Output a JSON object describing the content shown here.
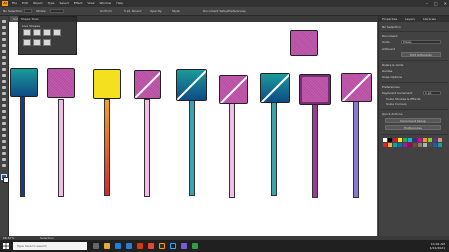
{
  "app": {
    "logo": "Ai"
  },
  "menu": [
    "File",
    "Edit",
    "Object",
    "Type",
    "Select",
    "Effect",
    "View",
    "Window",
    "Help"
  ],
  "window_controls": [
    "–",
    "□",
    "✕"
  ],
  "control_bar": {
    "label1": "No Selection",
    "label2": "Stroke",
    "label3": "Uniform",
    "label4": "5 pt. Round",
    "label5": "Opacity",
    "label6": "Style",
    "label7": "Document Setup",
    "label8": "Preferences"
  },
  "document_tab": "Untitled-1* @ 66.67 % (RGB/Preview)",
  "float_panel": {
    "title": "Shape Tools",
    "heading": "Live Shapes"
  },
  "right_panel": {
    "tabs": [
      "Properties",
      "Layers",
      "Libraries"
    ],
    "section": "No Selection",
    "document": "Document",
    "units_label": "Units",
    "units": "Pixels",
    "artboard_label": "Artboard",
    "edit_artboards": "Edit Artboards",
    "ruler_grids": "Rulers & Grids",
    "guides": "Guides",
    "snap": "Snap Options",
    "preferences": "Preferences",
    "keyboard_increment": "Keyboard Increment",
    "increment_value": "1 px",
    "scale_strokes": "Scale Strokes & Effects",
    "scale_corners": "Scale Corners",
    "quick_actions": "Quick Actions",
    "doc_setup": "Document Setup",
    "pref_btn": "Preferences"
  },
  "status": {
    "zoom": "66.67%",
    "tool": "Selection"
  },
  "taskbar": {
    "search": "Type here to search",
    "time": "10:02 AM",
    "date": "1/21/2021"
  },
  "colors": {
    "teal_blue_gradient": [
      "#1b9a9a",
      "#0e4b86"
    ],
    "purple": "#b44fa0",
    "yellow": "#f4e01f",
    "orange_red_stick": [
      "#f6a21c",
      "#d5262b"
    ],
    "pink_stick": "#f2bde6",
    "teal_stick": "#3aa3ad",
    "violet_stick": "#9b3c93",
    "periwinkle_stick": "#8a78d8",
    "navy_stick": "#143c8a"
  },
  "lollipops": [
    {
      "head": "teal-blue-gradient",
      "stick": "navy"
    },
    {
      "head": "purple-diagonal",
      "stick": "pink"
    },
    {
      "head": "yellow",
      "stick": "orange-red-gradient"
    },
    {
      "head": "purple-shine",
      "stick": "pink"
    },
    {
      "head": "teal-shine",
      "stick": "teal"
    },
    {
      "head": "purple-shine",
      "stick": "pink"
    },
    {
      "head": "teal-shine",
      "stick": "teal"
    },
    {
      "head": "purple-inset",
      "stick": "violet"
    },
    {
      "head": "purple-shine",
      "stick": "periwinkle"
    },
    {
      "head": "purple-standalone",
      "stick": "none"
    }
  ]
}
